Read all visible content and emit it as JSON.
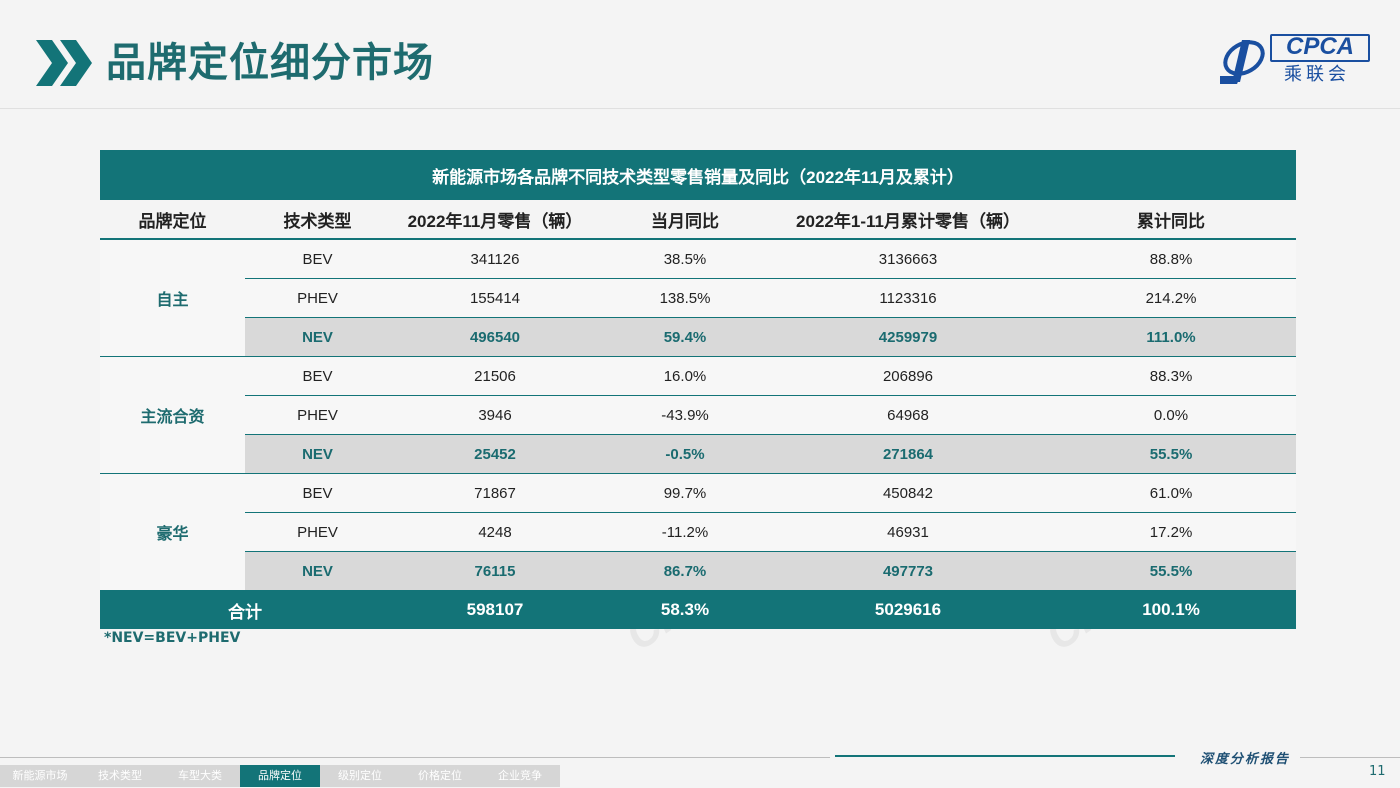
{
  "page": {
    "title": "品牌定位细分市场",
    "logo": {
      "name": "CPCA",
      "sub": "乘联会"
    },
    "footnote": "*NEV=BEV+PHEV",
    "report_tag": "深度分析报告",
    "page_number": "11"
  },
  "table": {
    "caption": "新能源市场各品牌不同技术类型零售销量及同比（2022年11月及累计）",
    "headers": [
      "品牌定位",
      "技术类型",
      "2022年11月零售（辆）",
      "当月同比",
      "2022年1-11月累计零售（辆）",
      "累计同比"
    ],
    "groups": [
      {
        "brand": "自主",
        "rows": [
          [
            "BEV",
            "341126",
            "38.5%",
            "3136663",
            "88.8%"
          ],
          [
            "PHEV",
            "155414",
            "138.5%",
            "1123316",
            "214.2%"
          ],
          [
            "NEV",
            "496540",
            "59.4%",
            "4259979",
            "111.0%"
          ]
        ]
      },
      {
        "brand": "主流合资",
        "rows": [
          [
            "BEV",
            "21506",
            "16.0%",
            "206896",
            "88.3%"
          ],
          [
            "PHEV",
            "3946",
            "-43.9%",
            "64968",
            "0.0%"
          ],
          [
            "NEV",
            "25452",
            "-0.5%",
            "271864",
            "55.5%"
          ]
        ]
      },
      {
        "brand": "豪华",
        "rows": [
          [
            "BEV",
            "71867",
            "99.7%",
            "450842",
            "61.0%"
          ],
          [
            "PHEV",
            "4248",
            "-11.2%",
            "46931",
            "17.2%"
          ],
          [
            "NEV",
            "76115",
            "86.7%",
            "497773",
            "55.5%"
          ]
        ]
      }
    ],
    "total": [
      "合计",
      "598107",
      "58.3%",
      "5029616",
      "100.1%"
    ]
  },
  "nav": {
    "tabs": [
      "新能源市场",
      "技术类型",
      "车型大类",
      "品牌定位",
      "级别定位",
      "价格定位",
      "企业竞争"
    ],
    "active": "品牌定位"
  },
  "colors": {
    "accent": "#137478",
    "title": "#1e6b6f",
    "nev_row": "#d9d9d9"
  }
}
